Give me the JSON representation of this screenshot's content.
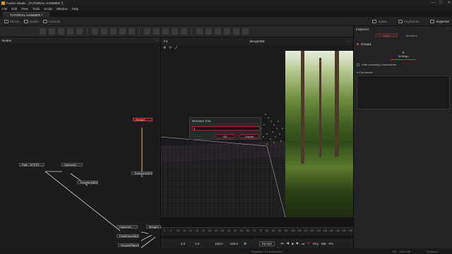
{
  "window": {
    "title": "Fusion Studio - [TUTORIAL HAMMER *]",
    "controls": [
      "—",
      "☐",
      "✕"
    ]
  },
  "menu": [
    "File",
    "Edit",
    "View",
    "Tools",
    "Script",
    "Window",
    "Help"
  ],
  "doc_tab": "TUTORIAL HAMMER *",
  "topbar": {
    "left": [
      "Effects",
      "Nodes",
      "Console"
    ],
    "right": [
      "Spline",
      "Keyframes",
      "Inspector"
    ]
  },
  "nodes_panel": {
    "title": "Nodes",
    "nodes": [
      {
        "id": "group1",
        "label": "Group1",
        "selected": true
      },
      {
        "id": "path",
        "label": "Path - BTEST...",
        "selected": false
      },
      {
        "id": "camera",
        "label": "Camera3...",
        "selected": false
      },
      {
        "id": "transform3d2",
        "label": "Transform3D2",
        "selected": false
      },
      {
        "id": "transform3d3",
        "label": "Transform3D3",
        "selected": false
      },
      {
        "id": "camera3d",
        "label": "Camera3...",
        "selected": false
      },
      {
        "id": "pointcloud",
        "label": "PointCloud3D2",
        "selected": false
      },
      {
        "id": "groundplane",
        "label": "GroundPlane1",
        "selected": false
      },
      {
        "id": "merge",
        "label": "Merge3...",
        "selected": false
      }
    ]
  },
  "viewer": {
    "title": "Merge3D5",
    "zoom": "Fit"
  },
  "rename_dialog": {
    "title": "Rename Tool",
    "value": "1",
    "ok": "OK",
    "cancel": "Cancel"
  },
  "transport": {
    "start": "0.0",
    "current": "0.0",
    "end": "150.0",
    "end2": "150.0",
    "render": "Render",
    "hiq": "HiQ",
    "mb": "MB",
    "prx": "Prx"
  },
  "timeline_ticks": [
    "0",
    "5",
    "10",
    "15",
    "20",
    "25",
    "30",
    "35",
    "40",
    "45",
    "50",
    "55",
    "60",
    "65",
    "70",
    "75",
    "80",
    "85",
    "90",
    "95",
    "100",
    "105",
    "110",
    "115",
    "120",
    "125",
    "130",
    "135",
    "140",
    "145"
  ],
  "status": {
    "center": "Playback: 0.0 frames/sec",
    "right": "8% - 2241 MB",
    "state": "Disabled"
  },
  "inspector": {
    "title": "Inspector",
    "tabs": [
      "Tools",
      "Modifiers"
    ],
    "node_name": "Group1",
    "settings_label": "Settings",
    "hide_connections": "Hide Incoming Connections",
    "comments_label": "Comments"
  },
  "colors": {
    "accent": "#c0392b",
    "bg": "#1c1c1e",
    "panel": "#232325"
  }
}
